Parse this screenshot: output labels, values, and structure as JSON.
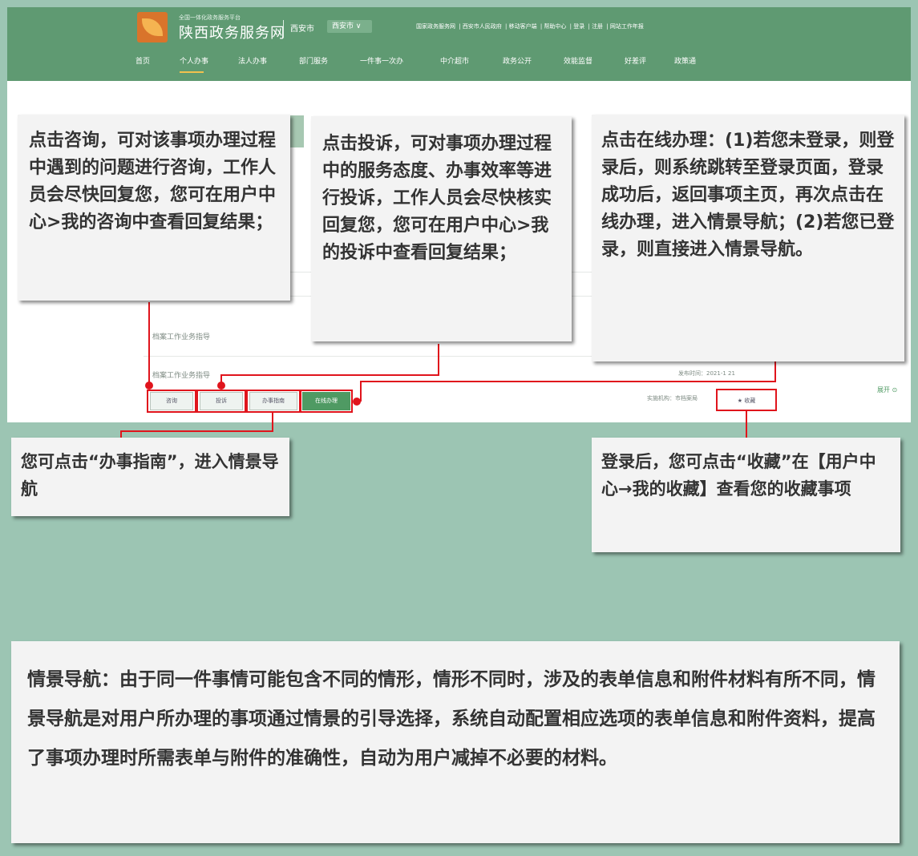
{
  "header": {
    "logo_subtitle": "全国一体化政务服务平台",
    "logo_title": "陕西政务服务网",
    "city_label": "西安市",
    "city_select": "西安市 ∨",
    "top_links": [
      "国家政务服务网",
      "西安市人民政府",
      "移动客户端",
      "帮助中心",
      "登录",
      "注册",
      "网站工作年报"
    ],
    "nav": [
      "首页",
      "个人办事",
      "法人办事",
      "部门服务",
      "一件事一次办",
      "中介超市",
      "政务公开",
      "效能监督",
      "好差评",
      "政策通"
    ]
  },
  "page": {
    "item_title_1": "档案工作业务指导",
    "item_title_2": "档案工作业务指导",
    "publish_time": "发布时间：2021-1  21",
    "org_label": "实施机构：市档案局",
    "expand_label": "展开",
    "buttons": {
      "consult": "咨询",
      "complaint": "投诉",
      "guide": "办事指南",
      "online": "在线办理",
      "favorite": "★ 收藏"
    }
  },
  "callouts": {
    "consult": "点击咨询，可对该事项办理过程中遇到的问题进行咨询，工作人员会尽快回复您，您可在用户中心>我的咨询中查看回复结果；",
    "complaint": "点击投诉，可对事项办理过程中的服务态度、办事效率等进行投诉，工作人员会尽快核实回复您，您可在用户中心>我的投诉中查看回复结果；",
    "online": "点击在线办理：(1)若您未登录，则登录后，则系统跳转至登录页面，登录成功后，返回事项主页，再次点击在线办理，进入情景导航；(2)若您已登录，则直接进入情景导航。",
    "guide": "您可点击“办事指南”，进入情景导航",
    "favorite": "登录后，您可点击“收藏”在【用户中心→我的收藏】查看您的收藏事项",
    "summary": "情景导航：由于同一件事情可能包含不同的情形，情形不同时，涉及的表单信息和附件材料有所不同，情景导航是对用户所办理的事项通过情景的引导选择，系统自动配置相应选项的表单信息和附件资料，提高了事项办理时所需表单与附件的准确性，自动为用户减掉不必要的材料。"
  },
  "colors": {
    "page_bg": "#9cc5b3",
    "header_green": "#5f9a72",
    "highlight_red": "#e0141c",
    "button_green": "#4f9a63",
    "callout_bg": "#f3f3f3"
  }
}
